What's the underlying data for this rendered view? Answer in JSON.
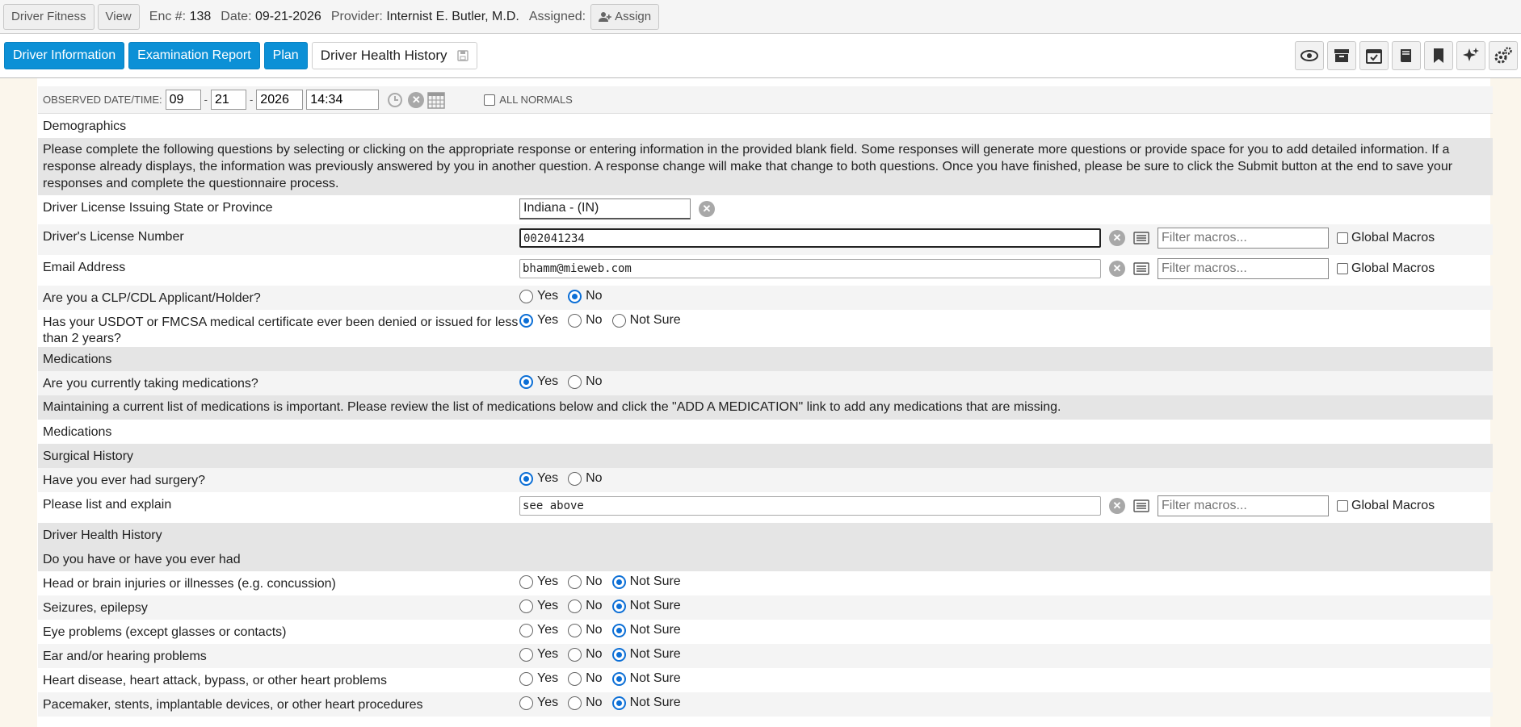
{
  "header": {
    "driver_fitness": "Driver Fitness",
    "view": "View",
    "enc_label": "Enc #:",
    "enc_value": "138",
    "date_label": "Date:",
    "date_value": "09-21-2026",
    "provider_label": "Provider:",
    "provider_value": "Internist E. Butler, M.D.",
    "assigned_label": "Assigned:",
    "assign_button": "Assign"
  },
  "tabs": {
    "driver_information": "Driver Information",
    "examination_report": "Examination Report",
    "plan": "Plan",
    "driver_health_history": "Driver Health History"
  },
  "observed": {
    "label": "OBSERVED DATE/TIME:",
    "month": "09",
    "day": "21",
    "year": "2026",
    "time": "14:34",
    "all_normals": "ALL NORMALS"
  },
  "demographics": {
    "title": "Demographics",
    "instructions": "Please complete the following questions by selecting or clicking on the appropriate response or entering information in the provided blank field. Some responses will generate more questions or provide space for you to add detailed information. If a response already displays, the information was previously answered by you in another question. A response change will make that change to both questions. Once you have finished, please be sure to click the Submit button at the end to save your responses and complete the questionnaire process.",
    "license_state_label": "Driver License Issuing State or Province",
    "license_state_value": "Indiana - (IN)",
    "license_number_label": "Driver's License Number",
    "license_number_value": "002041234",
    "email_label": "Email Address",
    "email_value": "bhamm@mieweb.com",
    "clp_label": "Are you a CLP/CDL Applicant/Holder?",
    "usdot_label": "Has your USDOT or FMCSA medical certificate ever been denied or issued for less than 2 years?"
  },
  "macros": {
    "placeholder": "Filter macros...",
    "global": "Global Macros"
  },
  "options": {
    "yes": "Yes",
    "no": "No",
    "not_sure": "Not Sure"
  },
  "medications": {
    "title": "Medications",
    "question": "Are you currently taking medications?",
    "note": "Maintaining a current list of medications is important. Please review the list of medications below and click the \"ADD A MEDICATION\" link to add any medications that are missing.",
    "list_label": "Medications"
  },
  "surgical": {
    "title": "Surgical History",
    "question": "Have you ever had surgery?",
    "explain_label": "Please list and explain",
    "explain_value": "see above"
  },
  "health": {
    "title": "Driver Health History",
    "subtitle": "Do you have or have you ever had",
    "items": [
      "Head or brain injuries or illnesses (e.g. concussion)",
      "Seizures, epilepsy",
      "Eye problems (except glasses or contacts)",
      "Ear and/or hearing problems",
      "Heart disease, heart attack, bypass, or other heart problems",
      "Pacemaker, stents, implantable devices, or other heart procedures"
    ]
  }
}
